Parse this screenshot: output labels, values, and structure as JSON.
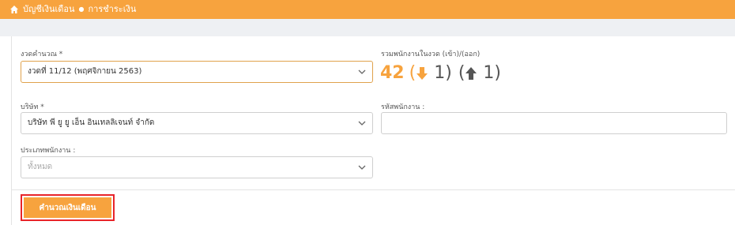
{
  "breadcrumb": {
    "home_icon": "home-icon",
    "item1": "บัญชีเงินเดือน",
    "separator": "●",
    "item2": "การชำระเงิน"
  },
  "form": {
    "period_label": "งวดคำนวณ *",
    "period_value": "งวดที่ 11/12 (พฤศจิกายน 2563)",
    "company_label": "บริษัท *",
    "company_value": "บริษัท พี ยู ยู เอ็น อินเทลลิเจนท์ จำกัด",
    "employee_type_label": "ประเภทพนักงาน :",
    "employee_type_value": "ทั้งหมด",
    "employee_code_label": "รหัสพนักงาน :",
    "employee_code_value": ""
  },
  "summary": {
    "label": "รวมพนักงานในงวด (เข้า)/(ออก)",
    "total": "42",
    "in_count": "1",
    "out_count": "1"
  },
  "actions": {
    "calculate_label": "คำนวณเงินเดือน"
  },
  "colors": {
    "accent": "#f7a33e",
    "highlight_border": "#e8242a"
  }
}
